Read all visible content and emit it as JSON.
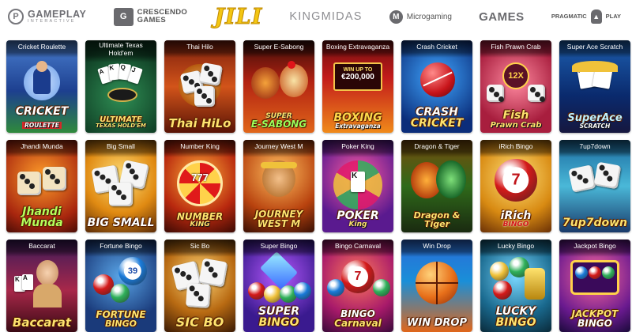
{
  "providers": [
    {
      "id": "gameplay",
      "name": "GAMEPLAY",
      "sub": "INTERACTIVE",
      "icon": "gameplay-logo-icon"
    },
    {
      "id": "crescendo",
      "name": "CRESCENDO",
      "name2": "GAMES",
      "icon": "crescendo-logo-icon"
    },
    {
      "id": "jili",
      "name": "JILI"
    },
    {
      "id": "kingmidas",
      "name": "KINGMIDAS"
    },
    {
      "id": "microgaming",
      "name": "Microgaming",
      "icon": "microgaming-logo-icon"
    },
    {
      "id": "games",
      "name": "GAMES"
    },
    {
      "id": "pragmatic",
      "name": "PRAGMATIC",
      "name2": "PLAY",
      "icon": "pragmatic-logo-icon"
    }
  ],
  "games": [
    {
      "title": "Cricket Roulette",
      "logo_top": "CRICKET",
      "logo_bottom": "ROULETTE"
    },
    {
      "title": "Ultimate Texas Hold'em",
      "logo_top": "ULTIMATE",
      "logo_bottom": "TEXAS HOLD'EM"
    },
    {
      "title": "Thai Hilo",
      "logo_top": "Thai HiLo",
      "logo_bottom": ""
    },
    {
      "title": "Super E-Sabong",
      "logo_top": "SUPER",
      "logo_bottom": "E-SABONG"
    },
    {
      "title": "Boxing Extravaganza",
      "logo_top": "BOXING",
      "logo_bottom": "Extravaganza",
      "badge": "WIN UP TO",
      "badge_value": "€200,000"
    },
    {
      "title": "Crash Cricket",
      "logo_top": "CRASH",
      "logo_bottom": "CRICKET"
    },
    {
      "title": "Fish Prawn Crab",
      "logo_top": "Fish",
      "logo_bottom": "Prawn Crab",
      "badge": "12X"
    },
    {
      "title": "Super Ace Scratch",
      "logo_top": "SuperAce",
      "logo_bottom": "SCRATCH"
    },
    {
      "title": "Jhandi Munda",
      "logo_top": "Jhandi",
      "logo_bottom": "Munda"
    },
    {
      "title": "Big Small",
      "logo_top": "BIG SMALL",
      "logo_bottom": ""
    },
    {
      "title": "Number King",
      "logo_top": "NUMBER",
      "logo_bottom": "KING",
      "badge": "777"
    },
    {
      "title": "Journey West M",
      "logo_top": "JOURNEY",
      "logo_bottom": "WEST M"
    },
    {
      "title": "Poker King",
      "logo_top": "POKER",
      "logo_bottom": "King"
    },
    {
      "title": "Dragon & Tiger",
      "logo_top": "Dragon & Tiger",
      "logo_bottom": ""
    },
    {
      "title": "iRich Bingo",
      "logo_top": "iRich",
      "logo_bottom": "BINGO",
      "badge": "7"
    },
    {
      "title": "7up7down",
      "logo_top": "7up7down",
      "logo_bottom": ""
    },
    {
      "title": "Baccarat",
      "logo_top": "Baccarat",
      "logo_bottom": ""
    },
    {
      "title": "Fortune Bingo",
      "logo_top": "FORTUNE",
      "logo_bottom": "BINGO",
      "badge": "39"
    },
    {
      "title": "Sic Bo",
      "logo_top": "SIC BO",
      "logo_bottom": ""
    },
    {
      "title": "Super Bingo",
      "logo_top": "SUPER",
      "logo_bottom": "BINGO"
    },
    {
      "title": "Bingo Carnaval",
      "logo_top": "BINGO",
      "logo_bottom": "Carnaval",
      "badge": "7"
    },
    {
      "title": "Win Drop",
      "logo_top": "WIN DROP",
      "logo_bottom": ""
    },
    {
      "title": "Lucky Bingo",
      "logo_top": "LUCKY",
      "logo_bottom": "BINGO"
    },
    {
      "title": "Jackpot Bingo",
      "logo_top": "JACKPOT",
      "logo_bottom": "BINGO"
    }
  ],
  "colors": {
    "tile_title_text": "#ffffff",
    "background": "#ffffff",
    "jili_gold": "#f3c612"
  }
}
